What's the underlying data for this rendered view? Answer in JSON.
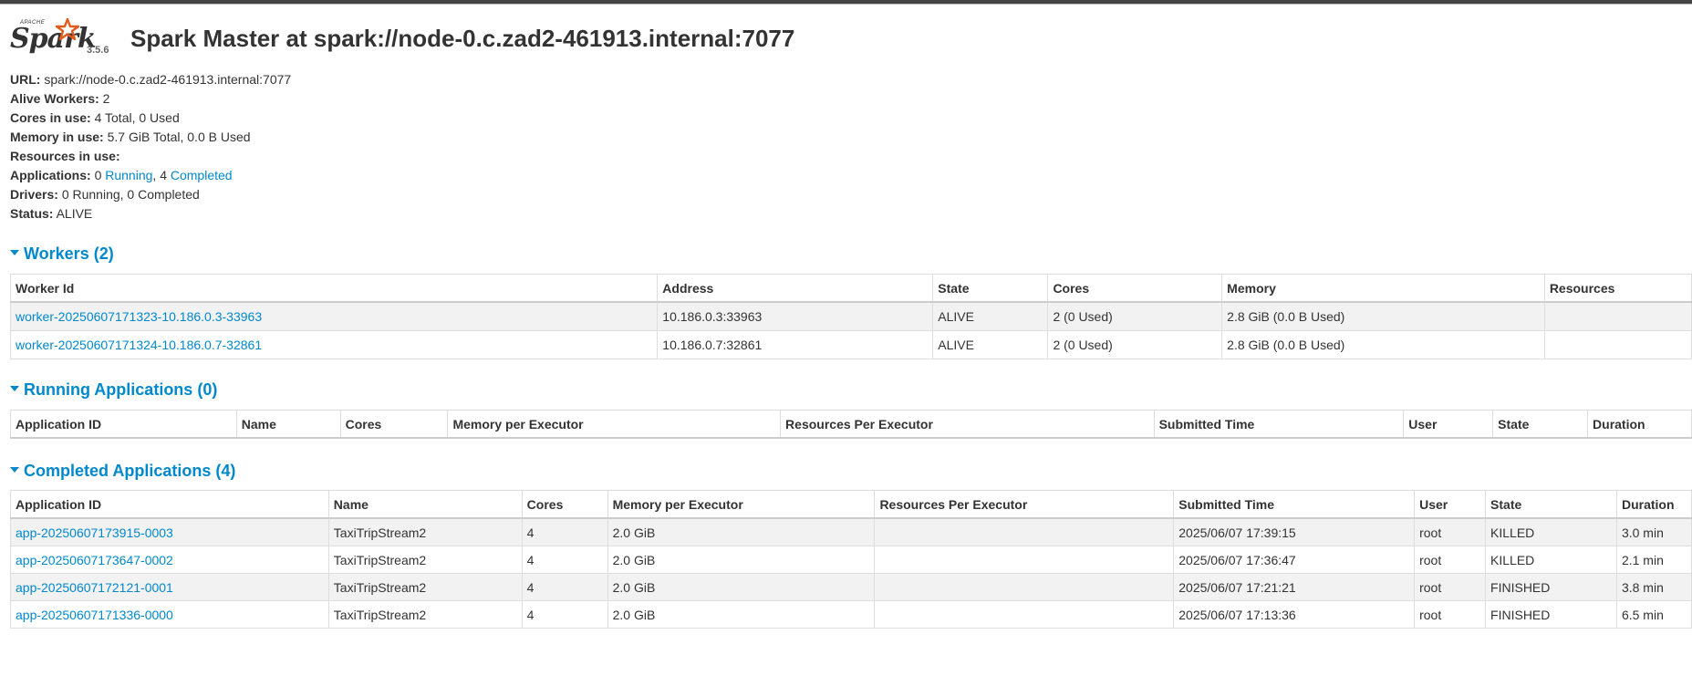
{
  "logo": {
    "apache": "APACHE",
    "name": "Spark",
    "version": "3.5.6"
  },
  "title": "Spark Master at spark://node-0.c.zad2-461913.internal:7077",
  "summary": {
    "url_label": "URL:",
    "url": "spark://node-0.c.zad2-461913.internal:7077",
    "alive_workers_label": "Alive Workers:",
    "alive_workers": "2",
    "cores_label": "Cores in use:",
    "cores": "4 Total, 0 Used",
    "memory_label": "Memory in use:",
    "memory": "5.7 GiB Total, 0.0 B Used",
    "resources_label": "Resources in use:",
    "applications_label": "Applications:",
    "apps_running_count": "0",
    "apps_running_link": "Running",
    "apps_completed_count": "4",
    "apps_completed_link": "Completed",
    "drivers_label": "Drivers:",
    "drivers": "0 Running, 0 Completed",
    "status_label": "Status:",
    "status": "ALIVE"
  },
  "workers": {
    "heading": "Workers (2)",
    "columns": [
      "Worker Id",
      "Address",
      "State",
      "Cores",
      "Memory",
      "Resources"
    ],
    "rows": [
      [
        "worker-20250607171323-10.186.0.3-33963",
        "10.186.0.3:33963",
        "ALIVE",
        "2 (0 Used)",
        "2.8 GiB (0.0 B Used)",
        ""
      ],
      [
        "worker-20250607171324-10.186.0.7-32861",
        "10.186.0.7:32861",
        "ALIVE",
        "2 (0 Used)",
        "2.8 GiB (0.0 B Used)",
        ""
      ]
    ]
  },
  "running_apps": {
    "heading": "Running Applications (0)",
    "columns": [
      "Application ID",
      "Name",
      "Cores",
      "Memory per Executor",
      "Resources Per Executor",
      "Submitted Time",
      "User",
      "State",
      "Duration"
    ]
  },
  "completed_apps": {
    "heading": "Completed Applications (4)",
    "columns": [
      "Application ID",
      "Name",
      "Cores",
      "Memory per Executor",
      "Resources Per Executor",
      "Submitted Time",
      "User",
      "State",
      "Duration"
    ],
    "rows": [
      [
        "app-20250607173915-0003",
        "TaxiTripStream2",
        "4",
        "2.0 GiB",
        "",
        "2025/06/07 17:39:15",
        "root",
        "KILLED",
        "3.0 min"
      ],
      [
        "app-20250607173647-0002",
        "TaxiTripStream2",
        "4",
        "2.0 GiB",
        "",
        "2025/06/07 17:36:47",
        "root",
        "KILLED",
        "2.1 min"
      ],
      [
        "app-20250607172121-0001",
        "TaxiTripStream2",
        "4",
        "2.0 GiB",
        "",
        "2025/06/07 17:21:21",
        "root",
        "FINISHED",
        "3.8 min"
      ],
      [
        "app-20250607171336-0000",
        "TaxiTripStream2",
        "4",
        "2.0 GiB",
        "",
        "2025/06/07 17:13:36",
        "root",
        "FINISHED",
        "6.5 min"
      ]
    ]
  },
  "colors": {
    "link": "#0088cc",
    "text": "#333333",
    "logo_star": "#e25a1c"
  }
}
